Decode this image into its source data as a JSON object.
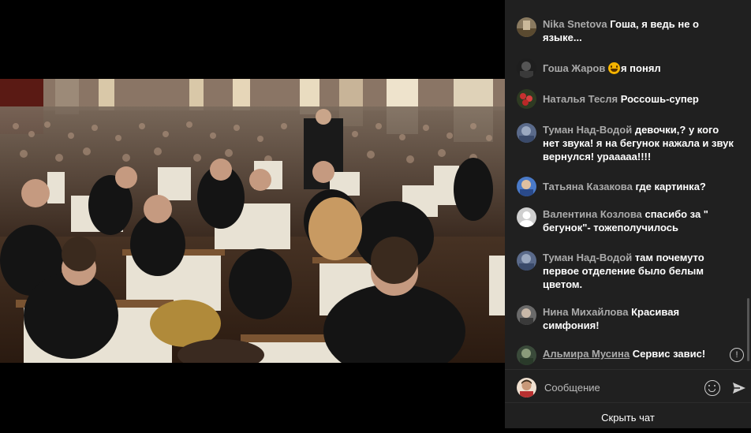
{
  "chat": {
    "messages": [
      {
        "author": "Nika Snetova",
        "text": "Гоша, я ведь не о языке...",
        "avatar": "landscape-avatar"
      },
      {
        "author": "Гоша Жаров",
        "emoji": "grinning-face-icon",
        "text": "я понял",
        "avatar": "dark-avatar"
      },
      {
        "author": "Наталья Тесля",
        "text": "Россошь-супер",
        "avatar": "flower-avatar"
      },
      {
        "author": "Туман Над-Водой",
        "text": "девочки,? у кого нет звука! я на бегунок нажала и звук вернулся! урааааа!!!!",
        "avatar": "blue-avatar"
      },
      {
        "author": "Татьяна Казакова",
        "text": "где картинка?",
        "avatar": "sky-avatar"
      },
      {
        "author": "Валентина Козлова",
        "text": "спасибо за \" бегунок\"- тожеполучилось",
        "avatar": "default-user-avatar"
      },
      {
        "author": "Туман Над-Водой",
        "text": "там почемуто первое отделение было белым цветом.",
        "avatar": "blue-avatar"
      },
      {
        "author": "Нина Михайлова",
        "text": "Красивая симфония!",
        "avatar": "portrait-avatar"
      },
      {
        "author": "Альмира Мусина",
        "text": "Сервис завис!",
        "avatar": "green-avatar",
        "author_underlined": true
      }
    ],
    "input_placeholder": "Сообщение",
    "hide_chat_label": "Скрыть чат",
    "report_icon": "exclamation-circle-icon",
    "emoji_icon": "smiley-icon",
    "send_icon": "send-arrow-icon",
    "colors": {
      "background": "#202020",
      "author": "#aaaaaa",
      "text": "#ffffff"
    }
  },
  "video": {
    "scene": "orchestra-concert-hall"
  }
}
